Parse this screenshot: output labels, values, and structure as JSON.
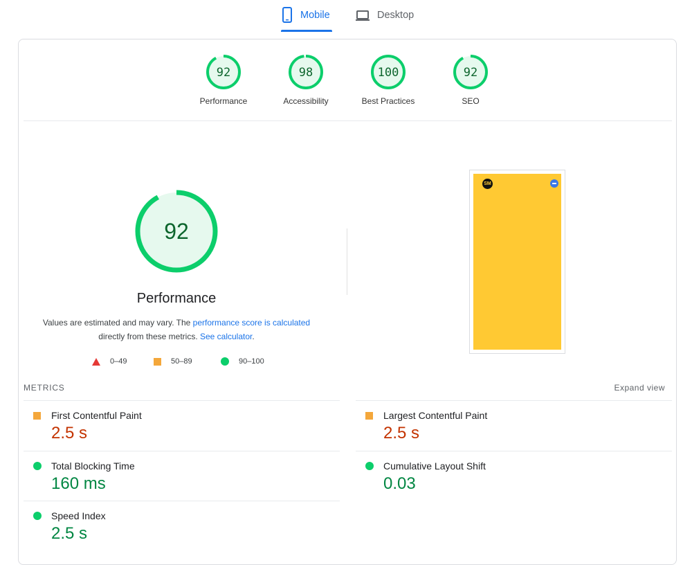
{
  "tabs": [
    {
      "label": "Mobile",
      "icon": "smartphone-icon",
      "active": true
    },
    {
      "label": "Desktop",
      "icon": "laptop-icon",
      "active": false
    }
  ],
  "categories": [
    {
      "score": "92",
      "label": "Performance"
    },
    {
      "score": "98",
      "label": "Accessibility"
    },
    {
      "score": "100",
      "label": "Best Practices"
    },
    {
      "score": "92",
      "label": "SEO"
    }
  ],
  "performance": {
    "score": "92",
    "title": "Performance",
    "desc_part1": "Values are estimated and may vary. The ",
    "desc_link1": "performance score is calculated",
    "desc_part2": " directly from these metrics. ",
    "desc_link2": "See calculator",
    "desc_part3": "."
  },
  "legend": [
    {
      "range": "0–49",
      "shape": "triangle",
      "color": "#e53935"
    },
    {
      "range": "50–89",
      "shape": "square",
      "color": "#f4a73b"
    },
    {
      "range": "90–100",
      "shape": "circle",
      "color": "#0cce6b"
    }
  ],
  "screenshot": {
    "logo_text": "SM",
    "background": "#ffc933"
  },
  "metrics": {
    "heading": "METRICS",
    "expand_label": "Expand view",
    "items": [
      {
        "name": "First Contentful Paint",
        "value": "2.5 s",
        "rating": "average"
      },
      {
        "name": "Largest Contentful Paint",
        "value": "2.5 s",
        "rating": "average"
      },
      {
        "name": "Total Blocking Time",
        "value": "160 ms",
        "rating": "pass"
      },
      {
        "name": "Cumulative Layout Shift",
        "value": "0.03",
        "rating": "pass"
      },
      {
        "name": "Speed Index",
        "value": "2.5 s",
        "rating": "pass"
      }
    ]
  },
  "colors": {
    "accent": "#1a73e8",
    "pass": "#0cce6b",
    "pass_text": "#018642",
    "average": "#f4a73b",
    "average_text": "#c33300",
    "fail": "#e53935"
  }
}
